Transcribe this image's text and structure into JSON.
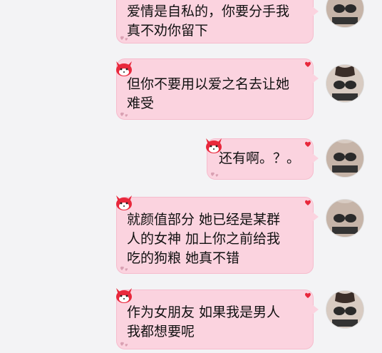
{
  "messages": [
    {
      "text": "爱情是自私的，你要分手我\n真不劝你留下"
    },
    {
      "text": "但你不要用以爱之名去让她\n难受"
    },
    {
      "text": "还有啊。？。"
    },
    {
      "text": "就颜值部分  她已经是某群\n人的女神  加上你之前给我\n吃的狗粮  她真不错"
    },
    {
      "text": "作为女朋友  如果我是男人\n我都想要呢"
    }
  ],
  "colors": {
    "bubble": "#fbd3df",
    "bubble_border": "#f6bccd",
    "background": "#f3f3f5",
    "accent": "#e8283c"
  },
  "icons": [
    "fox-sticker-icon",
    "heart-icon",
    "avatar"
  ]
}
